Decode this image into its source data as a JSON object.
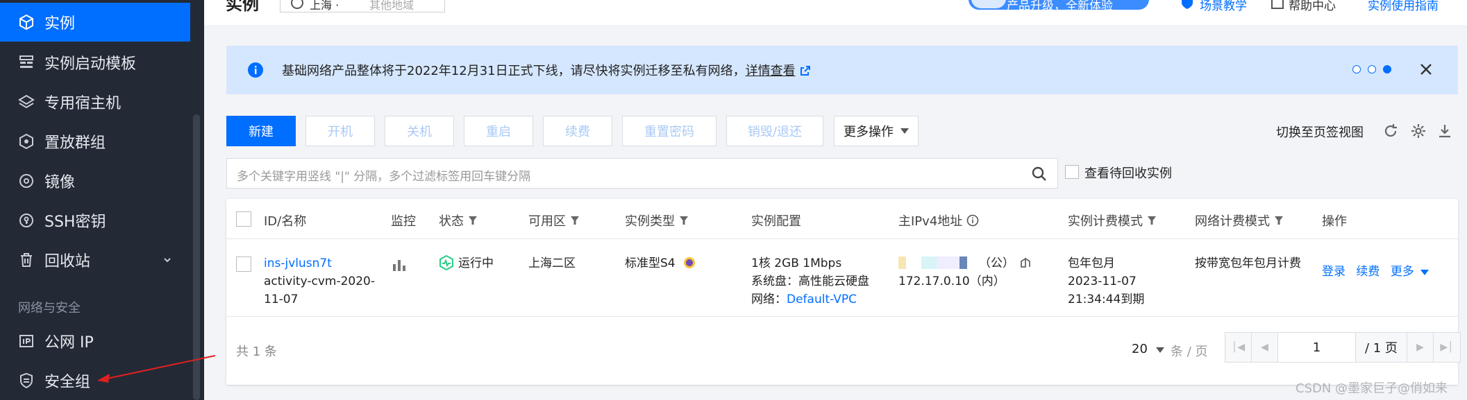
{
  "sidebar": {
    "items": [
      {
        "label": "实例",
        "icon": "cube-icon",
        "active": true
      },
      {
        "label": "实例启动模板",
        "icon": "template-icon"
      },
      {
        "label": "专用宿主机",
        "icon": "layers-icon"
      },
      {
        "label": "置放群组",
        "icon": "hexagon-icon"
      },
      {
        "label": "镜像",
        "icon": "disc-icon"
      },
      {
        "label": "SSH密钥",
        "icon": "key-icon"
      },
      {
        "label": "回收站",
        "icon": "trash-icon"
      },
      {
        "label": "公网 IP",
        "icon": "ip-icon"
      },
      {
        "label": "安全组",
        "icon": "shield-icon"
      }
    ],
    "section_network": "网络与安全"
  },
  "header": {
    "title": "实例",
    "region": "上海 ·",
    "region_hint": "其他地域",
    "promo": "产品升级，全新体验",
    "link1": "场景教学",
    "link2": "帮助中心",
    "link3": "实例使用指南"
  },
  "notice": {
    "text": "基础网络产品整体将于2022年12月31日正式下线，请尽快将实例迁移至私有网络，",
    "link": "详情查看"
  },
  "toolbar": {
    "new": "新建",
    "start": "开机",
    "stop": "关机",
    "restart": "重启",
    "renew": "续费",
    "reset_pwd": "重置密码",
    "destroy": "销毁/退还",
    "more": "更多操作",
    "switch_view": "切换至页签视图"
  },
  "search": {
    "placeholder": "多个关键字用竖线 \"|\" 分隔，多个过滤标签用回车键分隔",
    "recycle_label": "查看待回收实例"
  },
  "table": {
    "headers": {
      "id_name": "ID/名称",
      "monitor": "监控",
      "status": "状态",
      "zone": "可用区",
      "type": "实例类型",
      "config": "实例配置",
      "ipv4": "主IPv4地址",
      "billing": "实例计费模式",
      "net_billing": "网络计费模式",
      "actions": "操作"
    },
    "rows": [
      {
        "id": "ins-jvlusn7t",
        "name": "activity-cvm-2020-11-07",
        "status": "运行中",
        "zone": "上海二区",
        "type": "标准型S4",
        "config_line1": "1核 2GB 1Mbps",
        "config_line2": "系统盘：高性能云硬盘",
        "config_line3_label": "网络：",
        "config_vpc": "Default-VPC",
        "ip_public_suffix": "（公）",
        "ip_private": "172.17.0.10（内）",
        "billing_line1": "包年包月",
        "billing_line2": "2023-11-07",
        "billing_line3": "21:34:44到期",
        "net_billing": "按带宽包年包月计费",
        "action_login": "登录",
        "action_renew": "续费",
        "action_more": "更多"
      }
    ]
  },
  "pagination": {
    "total": "共 1 条",
    "page_size": "20",
    "unit": "条 / 页",
    "current": "1",
    "pages": "/ 1 页"
  },
  "watermark": "CSDN @墨家巨子@俏如来",
  "colors": {
    "accent": "#006eff",
    "sidebar_bg": "#232a36",
    "notice_bg": "#d5e7ff",
    "running": "#29cc85"
  }
}
